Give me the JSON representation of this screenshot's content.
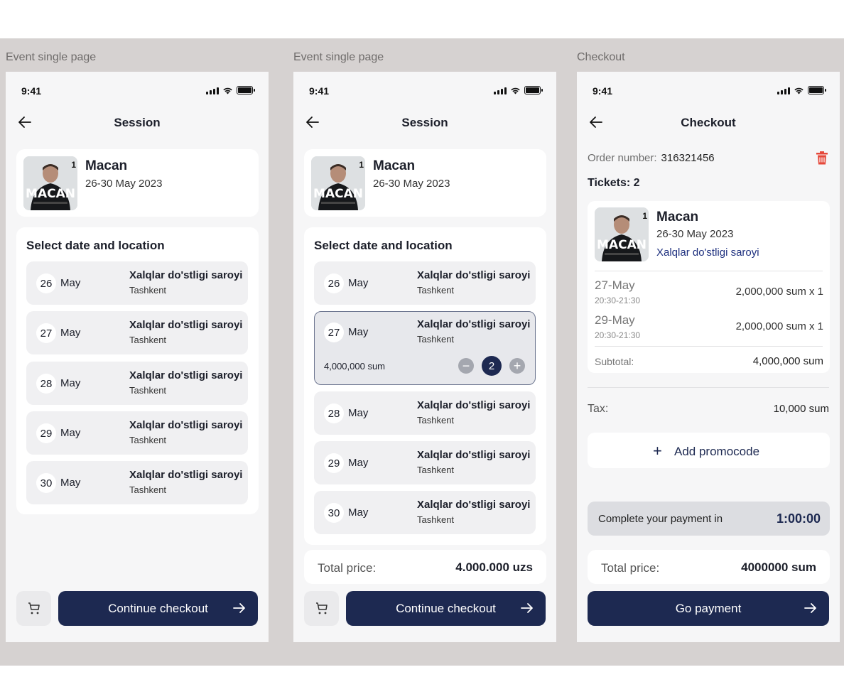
{
  "screens": [
    {
      "frame_label": "Event single page",
      "time": "9:41",
      "title": "Session",
      "event": {
        "name": "Macan",
        "dates": "26-30 May 2023",
        "poster_text": "MACAN",
        "poster_badge": "1"
      },
      "section_title": "Select date and location",
      "dates": [
        {
          "day": "26",
          "month": "May",
          "venue": "Xalqlar do'stligi saroyi",
          "city": "Tashkent"
        },
        {
          "day": "27",
          "month": "May",
          "venue": "Xalqlar do'stligi saroyi",
          "city": "Tashkent"
        },
        {
          "day": "28",
          "month": "May",
          "venue": "Xalqlar do'stligi saroyi",
          "city": "Tashkent"
        },
        {
          "day": "29",
          "month": "May",
          "venue": "Xalqlar do'stligi saroyi",
          "city": "Tashkent"
        },
        {
          "day": "30",
          "month": "May",
          "venue": "Xalqlar do'stligi saroyi",
          "city": "Tashkent"
        }
      ],
      "cta": "Continue checkout"
    },
    {
      "frame_label": "Event single page",
      "time": "9:41",
      "title": "Session",
      "event": {
        "name": "Macan",
        "dates": "26-30 May 2023",
        "poster_text": "MACAN",
        "poster_badge": "1"
      },
      "section_title": "Select date and location",
      "dates": [
        {
          "day": "26",
          "month": "May",
          "venue": "Xalqlar do'stligi saroyi",
          "city": "Tashkent"
        },
        {
          "day": "27",
          "month": "May",
          "venue": "Xalqlar do'stligi saroyi",
          "city": "Tashkent",
          "price": "4,000,000 sum",
          "quantity": "2",
          "minus": "−",
          "plus": "+"
        },
        {
          "day": "28",
          "month": "May",
          "venue": "Xalqlar do'stligi saroyi",
          "city": "Tashkent"
        },
        {
          "day": "29",
          "month": "May",
          "venue": "Xalqlar do'stligi saroyi",
          "city": "Tashkent"
        },
        {
          "day": "30",
          "month": "May",
          "venue": "Xalqlar do'stligi saroyi",
          "city": "Tashkent"
        }
      ],
      "total_label": "Total price:",
      "total_value": "4.000.000 uzs",
      "cta": "Continue checkout"
    },
    {
      "frame_label": "Checkout",
      "time": "9:41",
      "title": "Checkout",
      "order_label": "Order number:",
      "order_number": "316321456",
      "tickets_label": "Tickets: 2",
      "event": {
        "name": "Macan",
        "dates": "26-30 May 2023",
        "venue": "Xalqlar do'stligi saroyi",
        "poster_text": "MACAN",
        "poster_badge": "1"
      },
      "line_items": [
        {
          "date": "27-May",
          "time": "20:30-21:30",
          "price": "2,000,000 sum x 1"
        },
        {
          "date": "29-May",
          "time": "20:30-21:30",
          "price": "2,000,000 sum x 1"
        }
      ],
      "subtotal_label": "Subtotal:",
      "subtotal_value": "4,000,000 sum",
      "tax_label": "Tax:",
      "tax_value": "10,000 sum",
      "promo_icon": "+",
      "promo_label": "Add promocode",
      "timer_label": "Complete your payment in",
      "timer_value": "1:00:00",
      "total_label": "Total price:",
      "total_value": "4000000 sum",
      "cta": "Go payment"
    }
  ],
  "colors": {
    "primary": "#1d2951",
    "danger": "#e5483a",
    "canvas": "#d6d2d1"
  }
}
